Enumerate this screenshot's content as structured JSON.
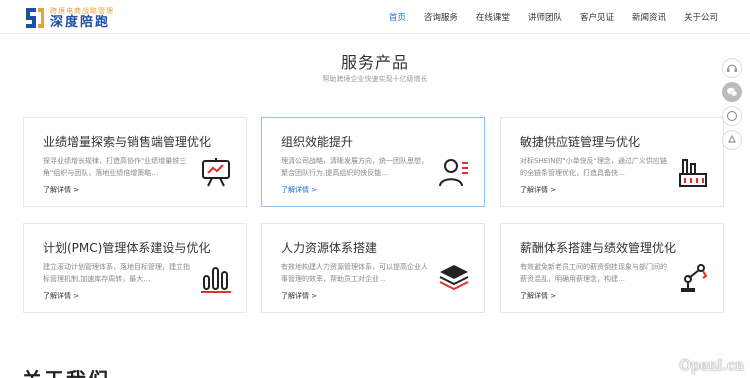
{
  "brand": {
    "subtitle": "跨境电商战略管理",
    "name": "深度陪跑"
  },
  "nav": [
    {
      "label": "首页",
      "active": true
    },
    {
      "label": "咨询服务",
      "active": false
    },
    {
      "label": "在线课堂",
      "active": false
    },
    {
      "label": "讲师团队",
      "active": false
    },
    {
      "label": "客户见证",
      "active": false
    },
    {
      "label": "新闻资讯",
      "active": false
    },
    {
      "label": "关于公司",
      "active": false
    }
  ],
  "section": {
    "title": "服务产品",
    "subtitle": "帮助跨境企业快速实现十亿级增长"
  },
  "cards": [
    {
      "title": "业绩增量探索与销售端管理优化",
      "desc": "探寻业绩增长规律，打造高协作\"业绩增量铁三角\"组织与团队，落地业绩倍增策略…",
      "more": "了解详情 >",
      "icon": "presentation-board-icon"
    },
    {
      "title": "组织效能提升",
      "desc": "理清公司战略，清晰发展方向，统一团队思想，聚合团队行为,提高组织的快反能…",
      "more": "了解详情 >",
      "icon": "person-list-icon"
    },
    {
      "title": "敏捷供应链管理与优化",
      "desc": "对标SHEIN的\"小单快反\"理念，通过广义供应链的全链条管理优化，打造具备快…",
      "more": "了解详情 >",
      "icon": "factory-icon"
    },
    {
      "title": "计划(PMC)管理体系建设与优化",
      "desc": "建立滚动计划管理体系，落地目标管理，建立指标管理机制,加速库存周转，最大…",
      "more": "了解详情 >",
      "icon": "bar-chart-icon"
    },
    {
      "title": "人力资源体系搭建",
      "desc": "有效地构建人力资源管理体系，可以提高企业人事管理的效率，帮助员工对企业…",
      "more": "了解详情 >",
      "icon": "layers-icon"
    },
    {
      "title": "薪酬体系搭建与绩效管理优化",
      "desc": "有效避免新老员工间的薪资倒挂现象与部门间的薪资混乱，明确用薪理念，构建…",
      "more": "了解详情 >",
      "icon": "robot-arm-icon"
    }
  ],
  "side_tools": [
    "headset-icon",
    "wechat-icon",
    "chat-icon",
    "arrow-up-icon"
  ],
  "about": {
    "title": "关于我们"
  },
  "watermark": "OpenI.cn",
  "colors": {
    "accent": "#1e6fd9",
    "icon_red": "#e0322d",
    "card_highlight_border": "#8cc3f0"
  }
}
